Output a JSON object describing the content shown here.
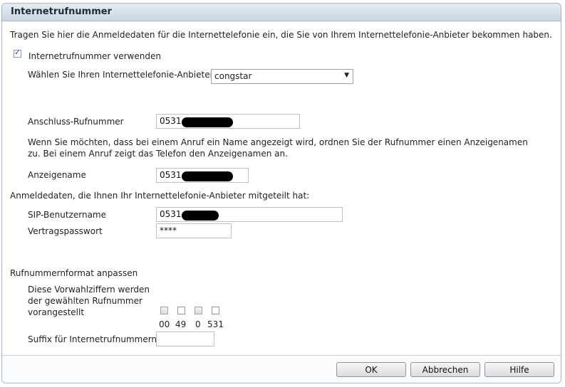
{
  "window": {
    "title": "Internetrufnummer"
  },
  "intro": "Tragen Sie hier die Anmeldedaten für die Internettelefonie ein, die Sie von Ihrem Internettelefonie-Anbieter bekommen haben.",
  "use_number": {
    "label": "Internetrufnummer verwenden",
    "checked": true
  },
  "provider": {
    "label": "Wählen Sie Ihren Internettelefonie-Anbieter",
    "selected": "congstar"
  },
  "anschluss": {
    "label": "Anschluss-Rufnummer",
    "value": "0531"
  },
  "display_name_hint": "Wenn Sie möchten, dass bei einem Anruf ein Name angezeigt wird, ordnen Sie der Rufnummer einen Anzeigenamen zu. Bei einem Anruf zeigt das Telefon den Anzeigenamen an.",
  "anzeigename": {
    "label": "Anzeigename",
    "value": "0531"
  },
  "credentials_heading": "Anmeldedaten, die Ihnen Ihr Internettelefonie-Anbieter mitgeteilt hat:",
  "sip_user": {
    "label": "SIP-Benutzername",
    "value": "0531"
  },
  "password": {
    "label": "Vertragspasswort",
    "value": "****"
  },
  "format_heading": "Rufnummernformat anpassen",
  "prefix": {
    "label": "Diese Vorwahlziffern werden der gewählten Rufnummer vorangestellt",
    "digits": [
      {
        "text": "00",
        "checked": false
      },
      {
        "text": "49",
        "checked": false
      },
      {
        "text": "0",
        "checked": false
      },
      {
        "text": "531",
        "checked": false
      }
    ]
  },
  "suffix": {
    "label": "Suffix für Internetrufnummern",
    "value": ""
  },
  "buttons": {
    "ok": "OK",
    "cancel": "Abbrechen",
    "help": "Hilfe"
  }
}
